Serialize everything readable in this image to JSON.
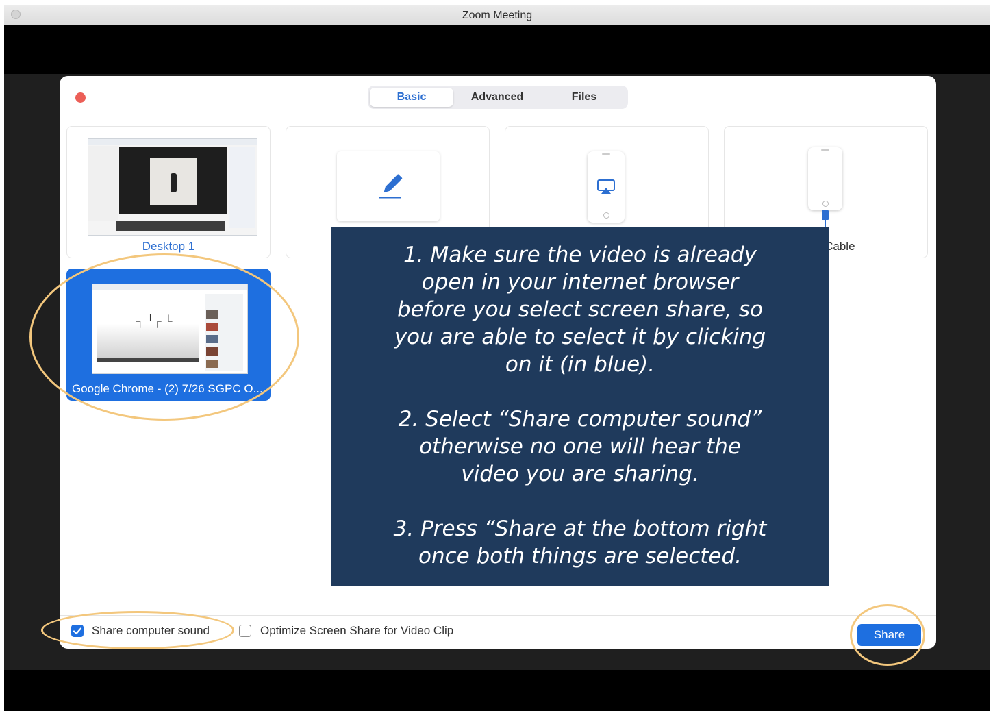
{
  "window": {
    "title": "Zoom Meeting"
  },
  "tabs": {
    "basic": "Basic",
    "advanced": "Advanced",
    "files": "Files"
  },
  "sources": {
    "desktop": {
      "label": "Desktop 1"
    },
    "whiteboard": {
      "label": ""
    },
    "iphone_airplay": {
      "label": ""
    },
    "iphone_cable": {
      "label": "d via Cable"
    },
    "chrome": {
      "label": "Google Chrome - (2) 7/26 SGPC O..."
    }
  },
  "footer": {
    "share_sound_label": "Share computer sound",
    "share_sound_checked": true,
    "optimize_label": "Optimize Screen Share for Video Clip",
    "optimize_checked": false,
    "share_button": "Share"
  },
  "instructions": {
    "step1": "1. Make sure the video is already\nopen in your internet browser\nbefore you select screen share, so\nyou are able to select it by clicking\non it (in blue).",
    "step2": "2. Select “Share computer sound”\notherwise no one will hear the\nvideo you are sharing.",
    "step3": "3. Press “Share at the bottom right\nonce both things are selected."
  },
  "colors": {
    "accent": "#1e6fe0",
    "overlay": "#1f3a5c",
    "annotation": "#f3c77d",
    "close": "#ec5f57"
  },
  "icons": {
    "whiteboard": "pencil-icon",
    "airplay": "airplay-icon",
    "cable": "cable-icon",
    "close": "close-dot-icon"
  }
}
